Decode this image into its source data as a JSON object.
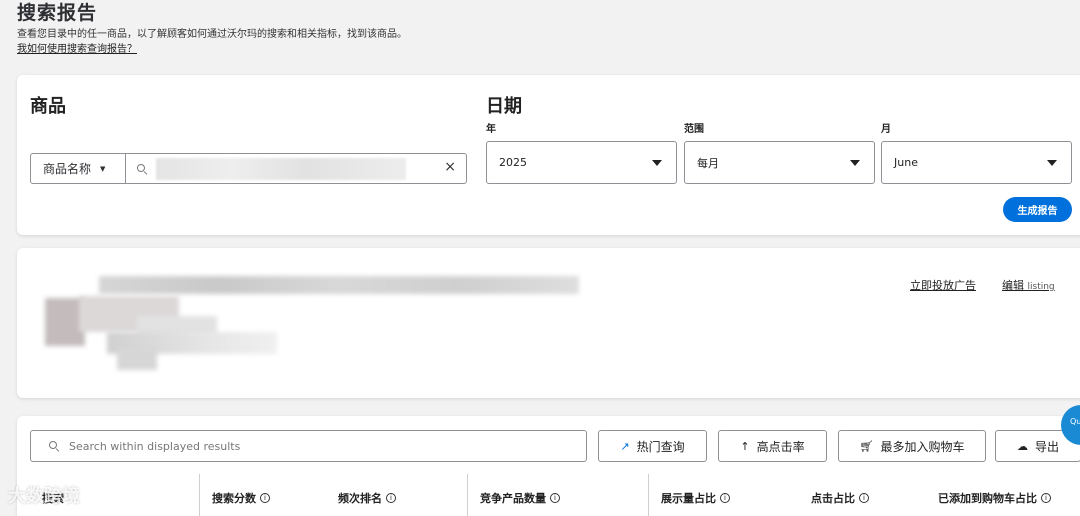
{
  "header": {
    "title": "搜索报告",
    "description": "查看您目录中的任一商品，以了解顾客如何通过沃尔玛的搜索和相关指标，找到该商品。",
    "help_link": "我如何使用搜索查询报告？"
  },
  "product_filter": {
    "title": "商品",
    "type_select": "商品名称",
    "clear_icon": "×"
  },
  "date_filter": {
    "title": "日期",
    "year_label": "年",
    "year_value": "2025",
    "range_label": "范围",
    "range_value": "每月",
    "month_label": "月",
    "month_value": "June"
  },
  "generate_button": "生成报告",
  "product_card": {
    "advertise_link": "立即投放广告",
    "edit_link": "编辑",
    "edit_link_suffix": "listing",
    "fragment": ""
  },
  "results": {
    "search_placeholder": "Search within displayed results",
    "buttons": {
      "trending": "热门查询",
      "top_ctr": "高点击率",
      "most_add_to_cart": "最多加入购物车",
      "export": "导出"
    },
    "columns": [
      "搜索",
      "搜索分数",
      "频次排名",
      "竞争产品数量",
      "展示量占比",
      "点击占比",
      "已添加到购物车占比"
    ]
  },
  "watermark": "大数跨境",
  "float_badge": "Qu Le",
  "icons": {
    "search": "search-icon",
    "clear": "close-icon",
    "dropdown": "chevron-down-icon",
    "trend": "trend-icon",
    "arrow_up": "arrow-up-icon",
    "cart": "cart-icon",
    "export": "cloud-download-icon",
    "info": "info-icon"
  }
}
